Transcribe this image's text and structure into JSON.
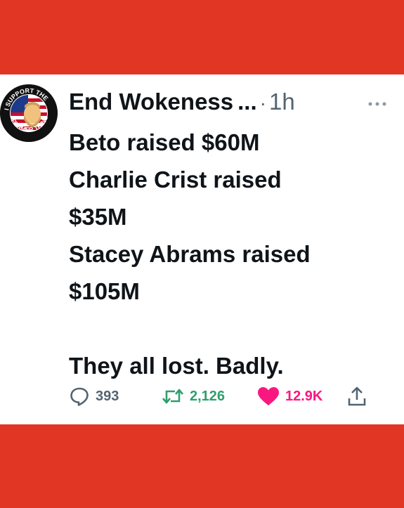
{
  "background": {
    "color": "#e23624"
  },
  "tweet": {
    "author_name": "End Wokeness",
    "name_ellipsis": "...",
    "separator": "·",
    "time": "1h",
    "more_icon": "more-horizontal-icon",
    "avatar": {
      "ring_top": "I SUPPORT THE",
      "ring_bottom": "FORMER THINGS"
    },
    "lines": [
      "Beto raised $60M",
      "Charlie Crist raised",
      "$35M",
      "Stacey Abrams raised",
      "$105M",
      "",
      "They all lost. Badly."
    ],
    "actions": {
      "replies": {
        "icon": "reply-icon",
        "count": "393",
        "color": "#536471"
      },
      "retweets": {
        "icon": "retweet-icon",
        "count": "2,126",
        "color": "#2f9e6d"
      },
      "likes": {
        "icon": "heart-icon",
        "count": "12.9K",
        "color": "#f91880"
      },
      "share": {
        "icon": "share-icon",
        "color": "#536471"
      }
    }
  }
}
